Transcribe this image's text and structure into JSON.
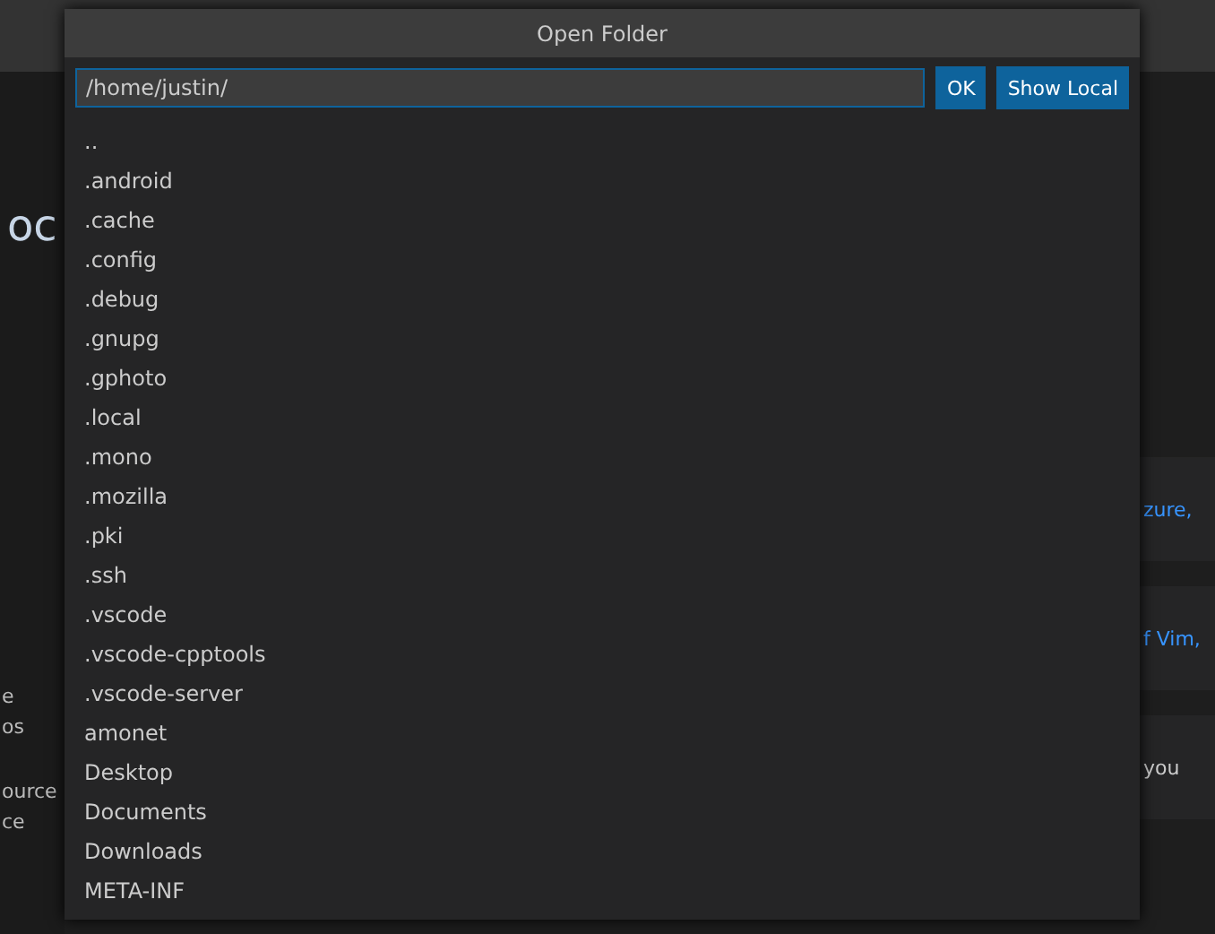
{
  "background": {
    "heading": "oc",
    "left_texts": [
      "e",
      "os",
      "ource",
      "ce"
    ],
    "right_texts": [
      {
        "text": "zure,",
        "kind": "link"
      },
      {
        "text": "f Vim,",
        "kind": "link"
      },
      {
        "text": "you",
        "kind": "plain"
      }
    ]
  },
  "dialog": {
    "title": "Open Folder",
    "path": "/home/justin/",
    "buttons": [
      "OK",
      "Show Local"
    ],
    "items": [
      {
        "name": ".."
      },
      {
        "name": ".android"
      },
      {
        "name": ".cache"
      },
      {
        "name": ".config"
      },
      {
        "name": ".debug"
      },
      {
        "name": ".gnupg"
      },
      {
        "name": ".gphoto"
      },
      {
        "name": ".local"
      },
      {
        "name": ".mono"
      },
      {
        "name": ".mozilla"
      },
      {
        "name": ".pki"
      },
      {
        "name": ".ssh"
      },
      {
        "name": ".vscode"
      },
      {
        "name": ".vscode-cpptools"
      },
      {
        "name": ".vscode-server"
      },
      {
        "name": "amonet"
      },
      {
        "name": "Desktop"
      },
      {
        "name": "Documents"
      },
      {
        "name": "Downloads"
      },
      {
        "name": "META-INF"
      }
    ]
  }
}
